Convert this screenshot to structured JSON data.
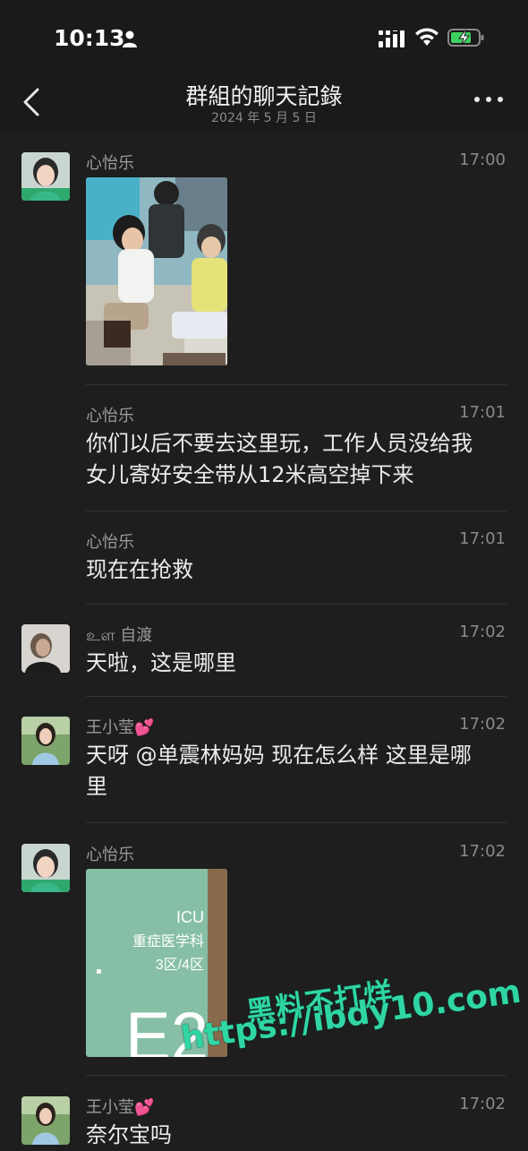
{
  "status_bar": {
    "time": "10:13"
  },
  "nav": {
    "title": "群組的聊天記錄",
    "subtitle": "2024 年 5 月 5 日"
  },
  "messages": [
    {
      "sender": "心怡乐",
      "time": "17:00",
      "type": "image",
      "image_desc": "photo-children-playground"
    },
    {
      "sender": "心怡乐",
      "time": "17:01",
      "text_lines": [
        "你们以后不要去这里玩，工作人员没给我",
        "女儿寄好安全带从12米高空掉下来"
      ]
    },
    {
      "sender": "心怡乐",
      "time": "17:01",
      "text_lines": [
        "现在在抢救"
      ]
    },
    {
      "sender": "உள 自渡",
      "time": "17:02",
      "text_lines": [
        "天啦，这是哪里"
      ]
    },
    {
      "sender": "王小莹💕",
      "time": "17:02",
      "text_lines": [
        "天呀 @单震林妈妈 现在怎么样 这里是哪",
        "里"
      ]
    },
    {
      "sender": "心怡乐",
      "time": "17:02",
      "type": "image",
      "image_text": [
        "ICU",
        "重症医学科",
        "3区/4区",
        "E2"
      ]
    },
    {
      "sender": "王小莹💕",
      "time": "17:02",
      "text_lines": [
        "奈尔宝吗"
      ]
    }
  ],
  "watermark": {
    "line1": "黑料不打烊",
    "line2": "https://ibdy10.com"
  }
}
